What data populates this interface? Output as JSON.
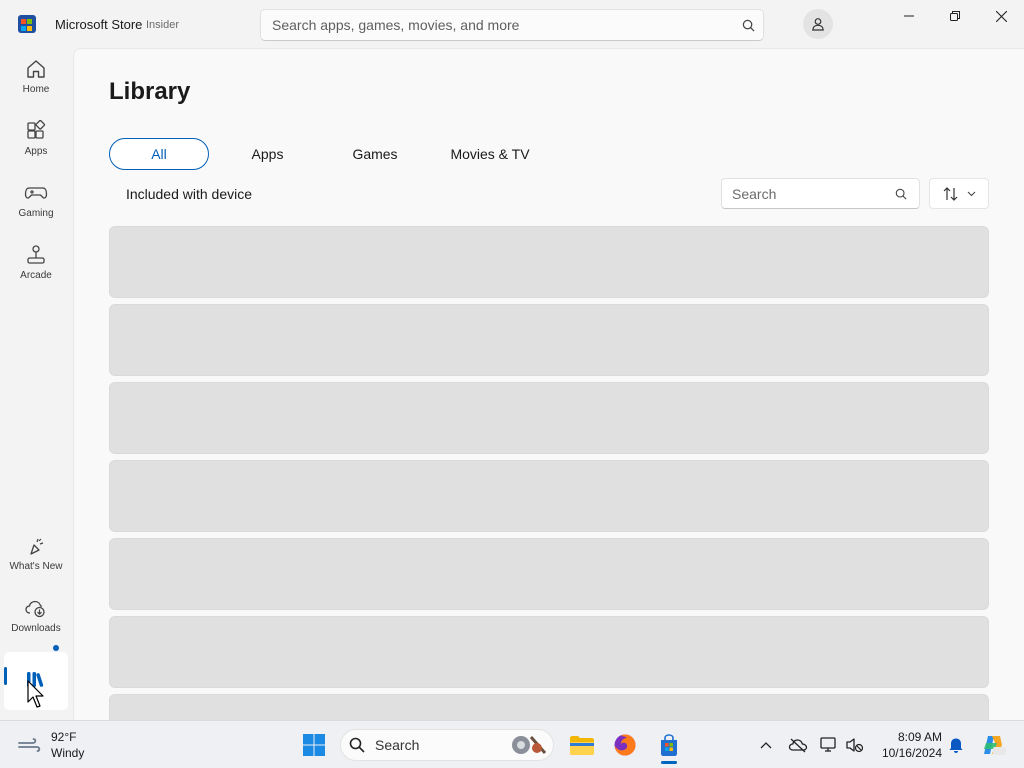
{
  "window": {
    "title": "Microsoft Store",
    "subtitle": "Insider",
    "search_placeholder": "Search apps, games, movies, and more"
  },
  "nav": {
    "items": [
      {
        "label": "Home",
        "icon": "home-icon"
      },
      {
        "label": "Apps",
        "icon": "apps-icon"
      },
      {
        "label": "Gaming",
        "icon": "gamepad-icon"
      },
      {
        "label": "Arcade",
        "icon": "joystick-icon"
      }
    ],
    "bottom_items": [
      {
        "label": "What's New",
        "icon": "sparkle-icon"
      },
      {
        "label": "Downloads",
        "icon": "cloud-download-icon",
        "has_badge": true
      },
      {
        "label": "",
        "icon": "library-icon",
        "active": true
      }
    ]
  },
  "library": {
    "title": "Library",
    "filters": [
      "All",
      "Apps",
      "Games",
      "Movies & TV",
      "Included with device"
    ],
    "active_filter": "All",
    "search_placeholder": "Search",
    "sort_icon": "sort-arrows-icon",
    "loading_rows": 7
  },
  "taskbar": {
    "weather": {
      "temp": "92°F",
      "desc": "Windy"
    },
    "search_label": "Search",
    "clock": {
      "time": "8:09 AM",
      "date": "10/16/2024"
    }
  },
  "colors": {
    "accent": "#005fb8",
    "skeleton": "#e0e0e0",
    "background": "#f3f3f3"
  }
}
